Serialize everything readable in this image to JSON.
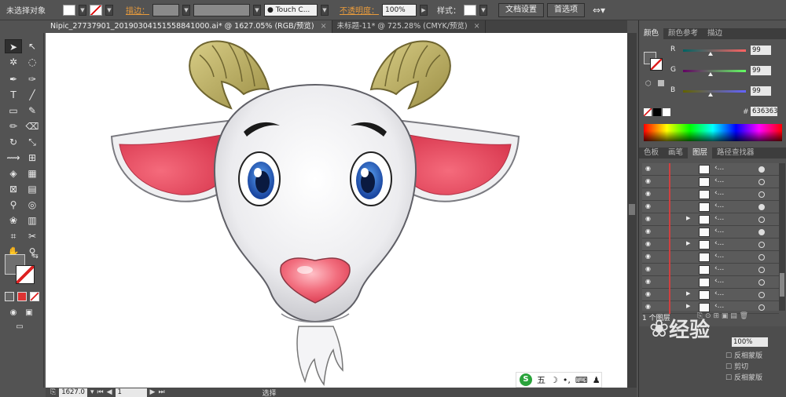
{
  "control_bar": {
    "selection_status": "未选择对象",
    "stroke_label": "描边：",
    "brush_name": "Touch C...",
    "opacity_label": "不透明度：",
    "opacity_value": "100%",
    "style_label": "样式：",
    "doc_setup_button": "文档设置",
    "preferences_button": "首选项"
  },
  "doc_tabs": [
    {
      "label": "Nipic_27737901_20190304151558841000.ai* @ 1627.05% (RGB/预览)",
      "close": "×"
    },
    {
      "label": "未标题-11* @ 725.28% (CMYK/预览)",
      "close": "×"
    }
  ],
  "color_panel": {
    "tabs": [
      "颜色",
      "颜色参考",
      "描边"
    ],
    "r_label": "R",
    "r_value": "99",
    "g_label": "G",
    "g_value": "99",
    "b_label": "B",
    "b_value": "99",
    "hex_label": "#",
    "hex_value": "636363"
  },
  "layers_panel": {
    "tabs": [
      "色板",
      "画笔",
      "图层",
      "路径查找器"
    ],
    "rows": [
      {
        "dots": "‹...",
        "expand": "",
        "target_filled": true
      },
      {
        "dots": "‹...",
        "expand": "",
        "target_filled": false
      },
      {
        "dots": "‹...",
        "expand": "",
        "target_filled": false
      },
      {
        "dots": "‹...",
        "expand": "",
        "target_filled": true
      },
      {
        "dots": "‹...",
        "expand": "▶",
        "target_filled": false
      },
      {
        "dots": "‹...",
        "expand": "",
        "target_filled": true
      },
      {
        "dots": "‹...",
        "expand": "▶",
        "target_filled": false
      },
      {
        "dots": "‹...",
        "expand": "",
        "target_filled": false
      },
      {
        "dots": "‹...",
        "expand": "",
        "target_filled": false
      },
      {
        "dots": "‹...",
        "expand": "",
        "target_filled": false
      },
      {
        "dots": "‹...",
        "expand": "▶",
        "target_filled": false
      },
      {
        "dots": "‹...",
        "expand": "▶",
        "target_filled": false
      }
    ],
    "layer_count": "1 个图层"
  },
  "lower_panel": {
    "items": [
      "反相蒙版",
      "剪切",
      "反相蒙版"
    ]
  },
  "status_bar": {
    "zoom": "1627.0",
    "artboard": "1",
    "mode": "选择"
  },
  "ime": {
    "logo": "S",
    "label": "五"
  },
  "watermark": {
    "text": "经验"
  },
  "colors": {
    "horn": "#c8bb6b",
    "face": "#ededf0",
    "ear_inner": "#e8485e",
    "nose": "#f0707e",
    "iris": "#2460b8"
  }
}
